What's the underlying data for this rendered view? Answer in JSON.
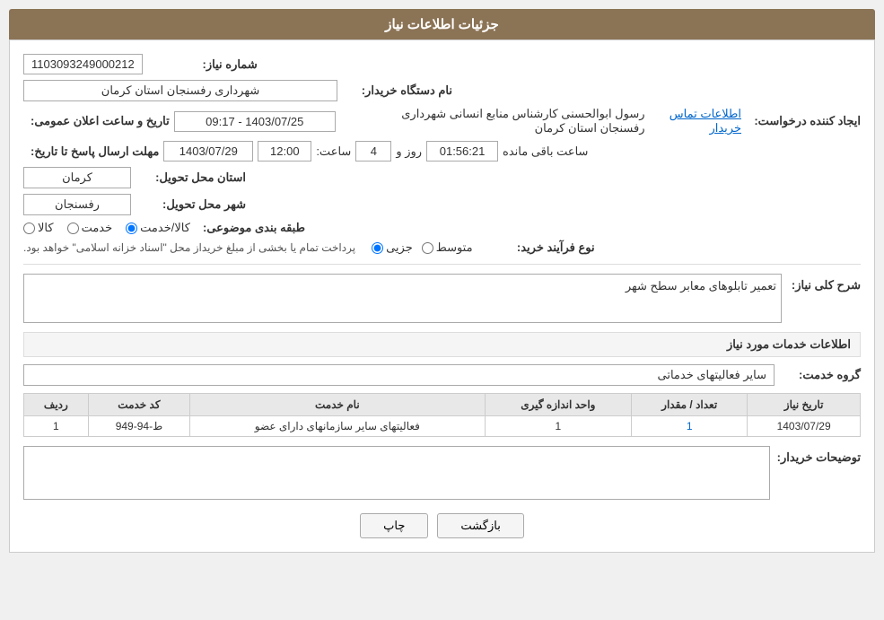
{
  "header": {
    "title": "جزئیات اطلاعات نیاز"
  },
  "labels": {
    "niyaz_number": "شماره نیاز:",
    "buyer_org": "نام دستگاه خریدار:",
    "requester": "ایجاد کننده درخواست:",
    "send_deadline": "مهلت ارسال پاسخ تا تاریخ:",
    "delivery_province": "استان محل تحویل:",
    "delivery_city": "شهر محل تحویل:",
    "category": "طبقه بندی موضوعی:",
    "process_type": "نوع فرآیند خرید:",
    "general_description": "شرح کلی نیاز:",
    "services_section": "اطلاعات خدمات مورد نیاز",
    "service_group": "گروه خدمت:",
    "row_num": "ردیف",
    "service_code": "کد خدمت",
    "service_name": "نام خدمت",
    "unit": "واحد اندازه گیری",
    "quantity": "تعداد / مقدار",
    "need_date": "تاریخ نیاز",
    "buyer_notes": "توضیحات خریدار:",
    "datetime_label": "تاریخ و ساعت اعلان عمومی:"
  },
  "values": {
    "niyaz_number": "1103093249000212",
    "buyer_org": "شهرداری رفسنجان استان کرمان",
    "requester_name": "رسول ابوالحسنی کارشناس منابع انسانی شهرداری رفسنجان استان کرمان",
    "contact_link": "اطلاعات تماس خریدار",
    "announce_datetime": "1403/07/25 - 09:17",
    "deadline_date": "1403/07/29",
    "deadline_time": "12:00",
    "deadline_days": "4",
    "deadline_remaining": "01:56:21",
    "remaining_label": "ساعت باقی مانده",
    "days_label": "روز و",
    "time_label": "ساعت:",
    "delivery_province": "کرمان",
    "delivery_city": "رفسنجان",
    "category_options": [
      "کالا",
      "خدمت",
      "کالا/خدمت"
    ],
    "selected_category": "کالا/خدمت",
    "process_options": [
      "جزیی",
      "متوسط"
    ],
    "process_note": "پرداخت تمام یا بخشی از مبلغ خریداز محل \"اسناد خزانه اسلامی\" خواهد بود.",
    "description": "تعمیر تابلوهای معابر سطح شهر",
    "service_group_value": "سایر فعالیتهای خدماتی",
    "table_rows": [
      {
        "row": "1",
        "code": "ط-94-949",
        "name": "فعالیتهای سایر سازمانهای دارای عضو",
        "unit": "1",
        "quantity": "1",
        "date": "1403/07/29"
      }
    ],
    "buyer_notes_value": ""
  },
  "buttons": {
    "print": "چاپ",
    "back": "بازگشت"
  }
}
